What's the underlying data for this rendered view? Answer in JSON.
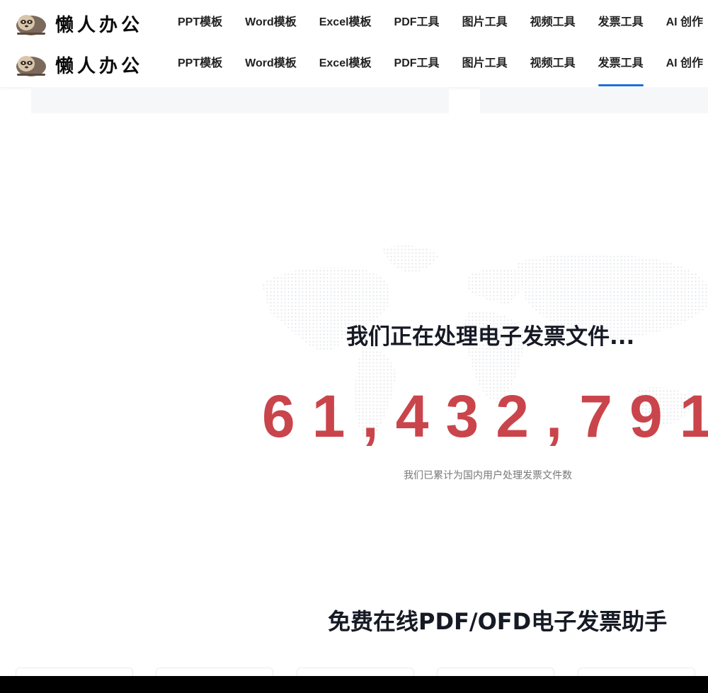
{
  "brand": {
    "name": "懒人办公",
    "logo_icon": "sloth-icon"
  },
  "nav": {
    "items": [
      {
        "label": "PPT模板"
      },
      {
        "label": "Word模板"
      },
      {
        "label": "Excel模板"
      },
      {
        "label": "PDF工具"
      },
      {
        "label": "图片工具"
      },
      {
        "label": "视频工具"
      },
      {
        "label": "发票工具"
      },
      {
        "label": "AI 创作"
      }
    ],
    "active_label": "发票工具",
    "accent_color": "#1e6fd9"
  },
  "hero": {
    "headline": "我们正在处理电子发票文件...",
    "counter": "61,432,791",
    "counter_color": "#c9454b",
    "subtext": "我们已累计为国内用户处理发票文件数"
  },
  "section": {
    "title": "免费在线PDF/OFD电子发票助手"
  }
}
